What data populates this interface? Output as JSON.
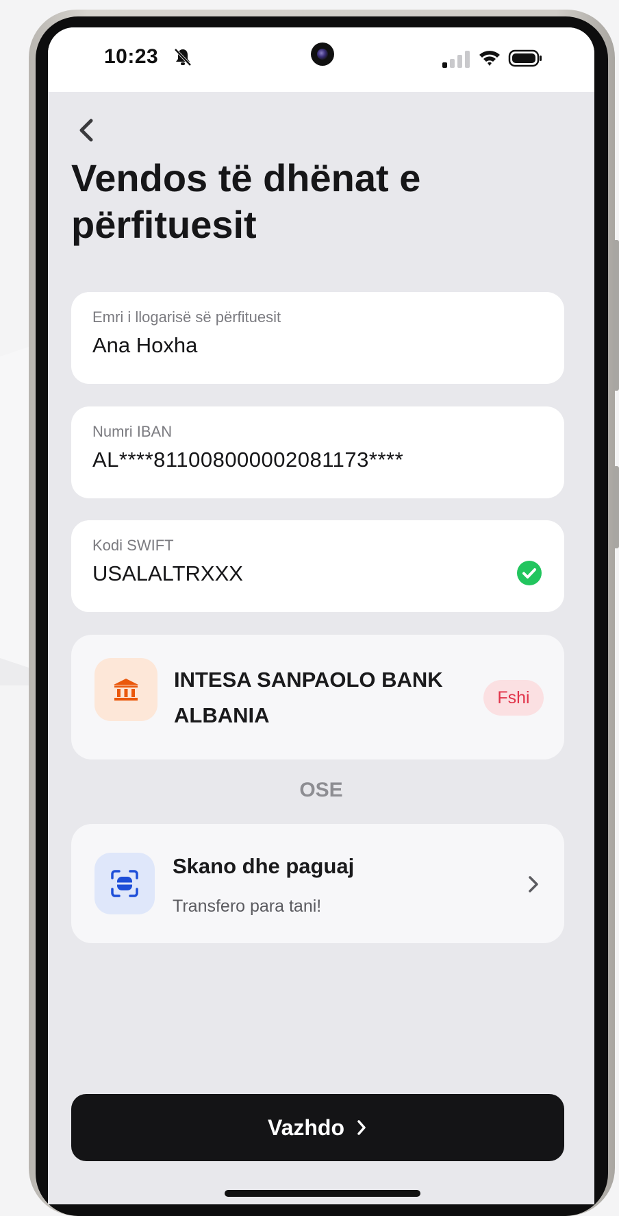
{
  "status_bar": {
    "time": "10:23",
    "icons": [
      "bell-slash-icon",
      "signal-icon",
      "wifi-icon",
      "battery-icon"
    ]
  },
  "header": {
    "back_icon": "chevron-left-icon",
    "title": "Vendos të dhënat e përfituesit"
  },
  "form": {
    "account_name": {
      "label": "Emri i llogarisë së përfituesit",
      "value": "Ana Hoxha"
    },
    "iban": {
      "label": "Numri IBAN",
      "value": "AL****811008000002081173****"
    },
    "swift": {
      "label": "Kodi SWIFT",
      "value": "USALALTRXXX",
      "status_icon": "check-circle-icon"
    }
  },
  "bank": {
    "icon": "bank-icon",
    "name": "INTESA SANPAOLO BANK ALBANIA",
    "delete_label": "Fshi"
  },
  "divider": {
    "or_label": "OSE"
  },
  "scan": {
    "icon": "scan-icon",
    "title": "Skano dhe paguaj",
    "subtitle": "Transfero para tani!",
    "chevron_icon": "chevron-right-icon"
  },
  "footer": {
    "continue_label": "Vazhdo",
    "continue_icon": "chevron-right-icon"
  },
  "colors": {
    "screen_bg": "#e8e8ec",
    "primary_button": "#141416",
    "success": "#22c55e",
    "danger": "#e1344a",
    "bank_accent": "#ea580c",
    "scan_accent": "#1d4ed8"
  }
}
